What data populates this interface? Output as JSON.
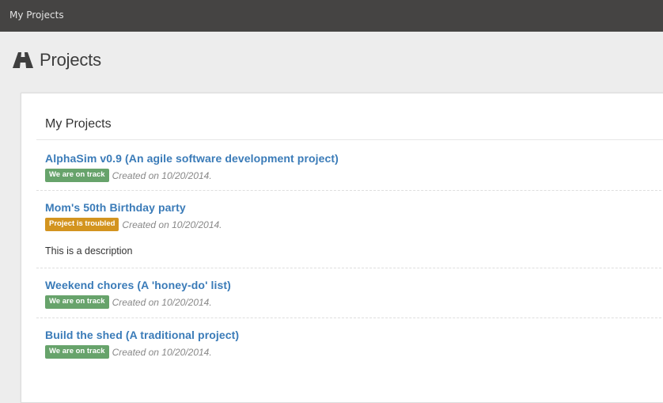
{
  "topbar": {
    "title": "My Projects"
  },
  "page": {
    "heading": "Projects",
    "heading_icon": "road-icon"
  },
  "panel": {
    "title": "My Projects"
  },
  "projects": [
    {
      "name": "AlphaSim v0.9 (An agile software development project)",
      "status": "We are on track",
      "status_color": "#67a36b",
      "created": "Created on 10/20/2014.",
      "description": ""
    },
    {
      "name": "Mom's 50th Birthday party",
      "status": "Project is troubled",
      "status_color": "#d3941f",
      "created": "Created on 10/20/2014.",
      "description": "This is a description"
    },
    {
      "name": "Weekend chores (A 'honey-do' list)",
      "status": "We are on track",
      "status_color": "#67a36b",
      "created": "Created on 10/20/2014.",
      "description": ""
    },
    {
      "name": "Build the shed (A traditional project)",
      "status": "We are on track",
      "status_color": "#67a36b",
      "created": "Created on 10/20/2014.",
      "description": ""
    }
  ],
  "colors": {
    "topbar_bg": "#454443",
    "link": "#3a7bb8",
    "on_track": "#67a36b",
    "troubled": "#d3941f"
  }
}
